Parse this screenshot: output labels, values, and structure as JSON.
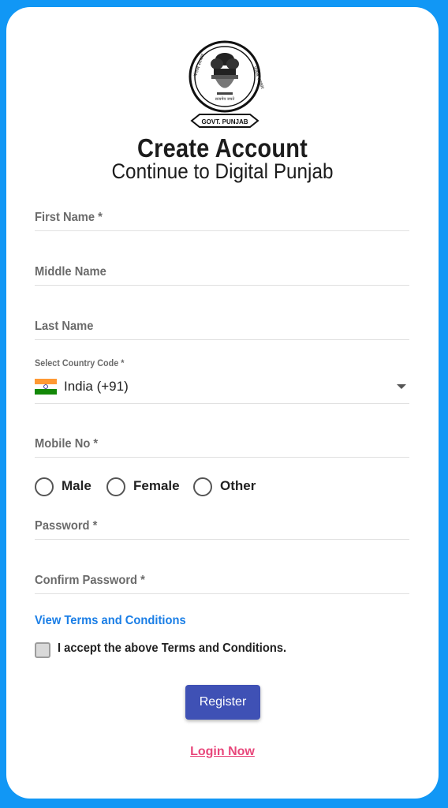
{
  "header": {
    "title": "Create Account",
    "subtitle": "Continue to Digital Punjab"
  },
  "emblem": {
    "text_left": "सत्यमेव जयते",
    "text_right": "पंजाब सरकार",
    "banner": "GOVT. PUNJAB"
  },
  "form": {
    "first_name_label": "First Name *",
    "middle_name_label": "Middle Name",
    "last_name_label": "Last Name",
    "country_code_label": "Select Country Code *",
    "country_code_value": "India (+91)",
    "mobile_label": "Mobile No *",
    "gender_options": [
      "Male",
      "Female",
      "Other"
    ],
    "password_label": "Password *",
    "confirm_password_label": "Confirm Password *"
  },
  "terms": {
    "link_text": "View Terms and Conditions",
    "checkbox_label": "I accept the above Terms and Conditions."
  },
  "actions": {
    "register_label": "Register",
    "login_label": "Login Now"
  },
  "colors": {
    "page_background": "#1197f5",
    "register_button": "#3f51b5",
    "terms_link": "#1a7ee6",
    "login_link": "#e8477b"
  }
}
